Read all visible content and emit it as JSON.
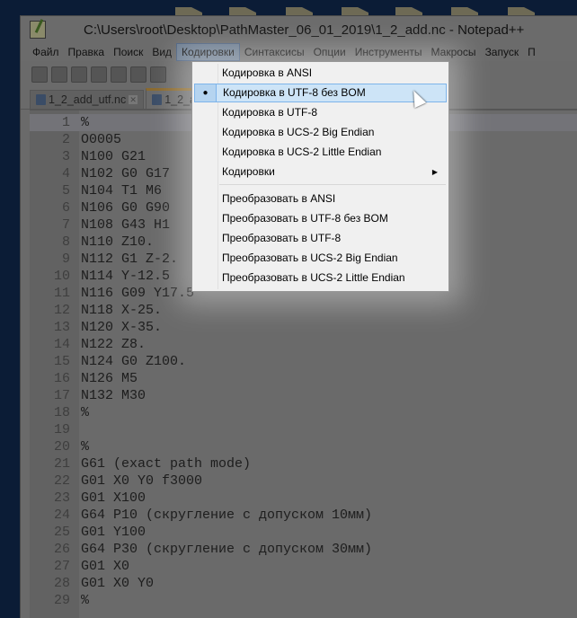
{
  "window": {
    "title": "C:\\Users\\root\\Desktop\\PathMaster_06_01_2019\\1_2_add.nc - Notepad++"
  },
  "menubar": [
    "Файл",
    "Правка",
    "Поиск",
    "Вид",
    "Кодировки",
    "Синтаксисы",
    "Опции",
    "Инструменты",
    "Макросы",
    "Запуск",
    "П"
  ],
  "active_menu": "Кодировки",
  "tabs": [
    {
      "label": "1_2_add_utf.nc",
      "active": false
    },
    {
      "label": "1_2_add.nc",
      "active": true
    }
  ],
  "encoding_menu": {
    "items": [
      {
        "label": "Кодировка в ANSI"
      },
      {
        "label": "Кодировка в UTF-8 без BOM",
        "checked": true,
        "hovered": true
      },
      {
        "label": "Кодировка в UTF-8"
      },
      {
        "label": "Кодировка в UCS-2 Big Endian"
      },
      {
        "label": "Кодировка в UCS-2 Little Endian"
      },
      {
        "label": "Кодировки",
        "submenu": true
      }
    ],
    "convert_items": [
      {
        "label": "Преобразовать в ANSI"
      },
      {
        "label": "Преобразовать в UTF-8 без BOM"
      },
      {
        "label": "Преобразовать в UTF-8"
      },
      {
        "label": "Преобразовать в UCS-2 Big Endian"
      },
      {
        "label": "Преобразовать в UCS-2 Little Endian"
      }
    ]
  },
  "editor": {
    "current_line": 1,
    "lines": [
      "%",
      "O0005",
      "N100 G21",
      "N102 G0 G17",
      "N104 T1 M6",
      "N106 G0 G90",
      "N108 G43 H1",
      "N110 Z10.",
      "N112 G1 Z-2.",
      "N114 Y-12.5",
      "N116 G09 Y17.5",
      "N118 X-25.",
      "N120 X-35.",
      "N122 Z8.",
      "N124 G0 Z100.",
      "N126 M5",
      "N132 M30",
      "%",
      "",
      "%",
      "G61 (exact path mode)",
      "G01 X0 Y0 f3000",
      "G01 X100",
      "G64 P10 (скругление с допуском 10мм)",
      "G01 Y100",
      "G64 P30 (скругление с допуском 30мм)",
      "G01 X0",
      "G01 X0 Y0",
      "%"
    ]
  }
}
